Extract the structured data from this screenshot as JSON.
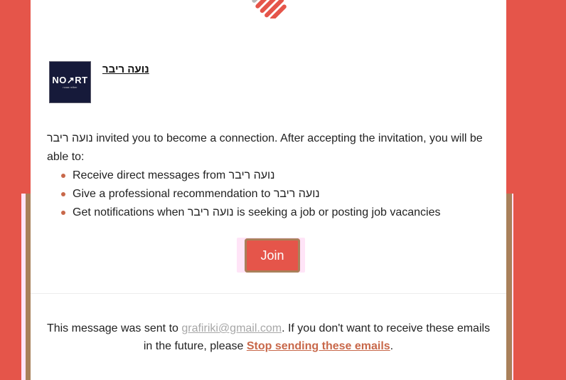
{
  "sender": {
    "name": "נועה ריבר",
    "avatar_logo": "NO↗RT",
    "avatar_sub": "noaa reiber"
  },
  "message": {
    "intro_text": "נועה ריבר invited you to become a connection. After accepting the invitation, you will be able to:",
    "bullets": [
      "Receive direct messages from נועה ריבר",
      "Give a professional recommendation to נועה ריבר",
      "Get notifications when נועה ריבר is seeking a job or posting job vacancies"
    ]
  },
  "cta": {
    "join_label": "Join"
  },
  "footer": {
    "prefix": "This message was sent to ",
    "email": "grafiriki@gmail.com",
    "middle": ". If you don't want to receive these emails in the future, please ",
    "stop_link": "Stop sending these emails",
    "suffix": "."
  },
  "colors": {
    "background": "#e5554a",
    "accent": "#c8684a",
    "button": "#e5554a"
  },
  "icons": {
    "top_logo": "stripes-logo-icon",
    "bullet": "bullet-dot-icon"
  }
}
